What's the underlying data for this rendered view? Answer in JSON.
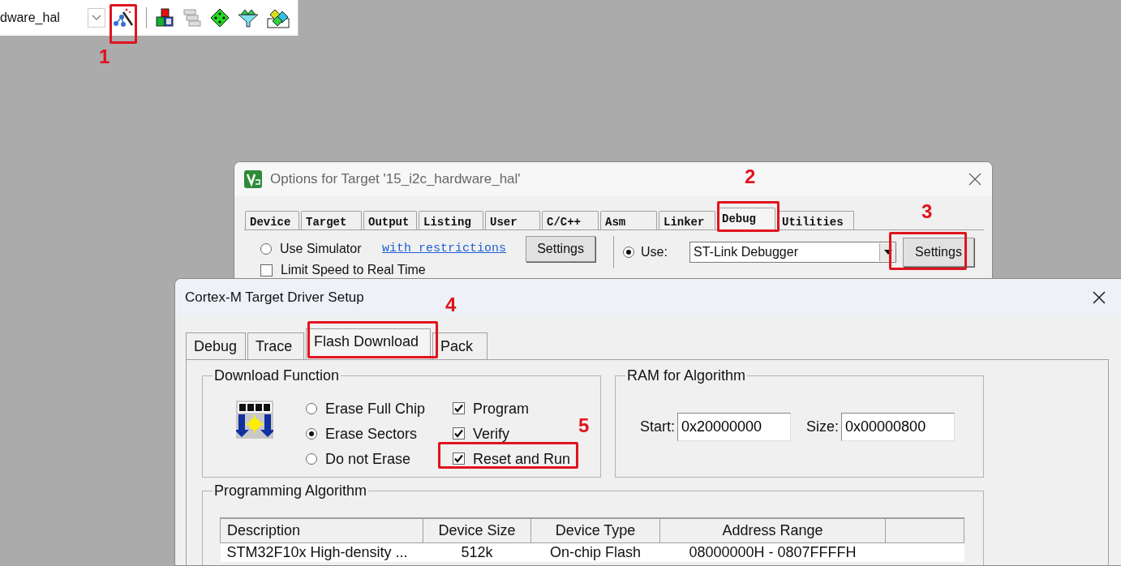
{
  "toolbar": {
    "project": "dware_hal"
  },
  "options_window": {
    "title": "Options for Target '15_i2c_hardware_hal'",
    "tabs": [
      {
        "label": "Device",
        "selected": false
      },
      {
        "label": "Target",
        "selected": false
      },
      {
        "label": "Output",
        "selected": false
      },
      {
        "label": "Listing",
        "selected": false
      },
      {
        "label": "User",
        "selected": false
      },
      {
        "label": "C/C++",
        "selected": false
      },
      {
        "label": "Asm",
        "selected": false
      },
      {
        "label": "Linker",
        "selected": false
      },
      {
        "label": "Debug",
        "selected": true
      },
      {
        "label": "Utilities",
        "selected": false
      }
    ],
    "simulator": {
      "label": "Use Simulator",
      "selected": false
    },
    "restrictions_link": "with restrictions",
    "simulator_settings": "Settings",
    "use": {
      "label": "Use:",
      "selected": true
    },
    "debugger": "ST-Link Debugger",
    "debugger_settings": "Settings",
    "limit_speed": {
      "label": "Limit Speed to Real Time",
      "checked": false
    }
  },
  "driver_window": {
    "title": "Cortex-M Target Driver Setup",
    "tabs": [
      {
        "label": "Debug",
        "selected": false
      },
      {
        "label": "Trace",
        "selected": false
      },
      {
        "label": "Flash Download",
        "selected": true
      },
      {
        "label": "Pack",
        "selected": false
      }
    ],
    "download_function": {
      "title": "Download Function",
      "erase_options": [
        {
          "label": "Erase Full Chip",
          "selected": false
        },
        {
          "label": "Erase Sectors",
          "selected": true
        },
        {
          "label": "Do not Erase",
          "selected": false
        }
      ],
      "options": [
        {
          "label": "Program",
          "checked": true
        },
        {
          "label": "Verify",
          "checked": true
        },
        {
          "label": "Reset and Run",
          "checked": true
        }
      ]
    },
    "ram": {
      "title": "RAM for Algorithm",
      "start_label": "Start:",
      "start": "0x20000000",
      "size_label": "Size:",
      "size": "0x00000800"
    },
    "programming": {
      "title": "Programming Algorithm",
      "columns": [
        "Description",
        "Device Size",
        "Device Type",
        "Address Range"
      ],
      "rows": [
        [
          "STM32F10x High-density ...",
          "512k",
          "On-chip Flash",
          "08000000H - 0807FFFFH"
        ]
      ]
    }
  },
  "annotations": [
    {
      "label": "1"
    },
    {
      "label": "2"
    },
    {
      "label": "3"
    },
    {
      "label": "4"
    },
    {
      "label": "5"
    }
  ]
}
